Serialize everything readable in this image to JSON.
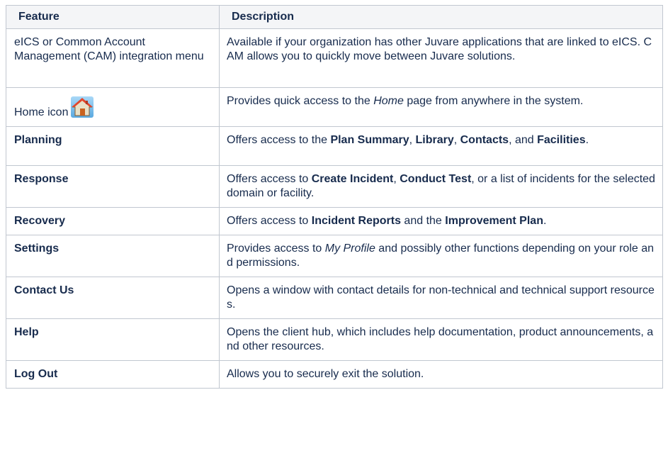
{
  "table": {
    "headers": [
      "Feature",
      "Description"
    ],
    "rows": [
      {
        "feature": "eICS or Common Account Management (CAM) integration menu",
        "feature_bold": false,
        "description": [
          {
            "text": "Available if your organization has other Juvare applications that are linked to eICS. CAM allows you to quickly move between Juvare solutions."
          }
        ]
      },
      {
        "feature": "Home icon",
        "feature_bold": false,
        "icon": "home-icon",
        "description": [
          {
            "text": "Provides quick access to the "
          },
          {
            "text": "Home",
            "style": "italic"
          },
          {
            "text": " page from anywhere in the system."
          }
        ]
      },
      {
        "feature": "Planning",
        "feature_bold": true,
        "description": [
          {
            "text": "Offers access to the "
          },
          {
            "text": "Plan Summary",
            "style": "bold"
          },
          {
            "text": ", "
          },
          {
            "text": "Library",
            "style": "bold"
          },
          {
            "text": ", "
          },
          {
            "text": "Contacts",
            "style": "bold"
          },
          {
            "text": ", and "
          },
          {
            "text": "Facilities",
            "style": "bold"
          },
          {
            "text": "."
          }
        ]
      },
      {
        "feature": "Response",
        "feature_bold": true,
        "description": [
          {
            "text": "Offers access to "
          },
          {
            "text": "Create Incident",
            "style": "bold"
          },
          {
            "text": ", "
          },
          {
            "text": "Conduct Test",
            "style": "bold"
          },
          {
            "text": ", or a list of incidents for the selected domain or facility."
          }
        ]
      },
      {
        "feature": "Recovery",
        "feature_bold": true,
        "description": [
          {
            "text": "Offers access to "
          },
          {
            "text": "Incident Reports",
            "style": "bold"
          },
          {
            "text": " and the "
          },
          {
            "text": "Improvement Plan",
            "style": "bold"
          },
          {
            "text": "."
          }
        ]
      },
      {
        "feature": "Settings",
        "feature_bold": true,
        "description": [
          {
            "text": "Provides access to "
          },
          {
            "text": "My Profile",
            "style": "italic"
          },
          {
            "text": " and possibly other functions depending on your role and permissions."
          }
        ]
      },
      {
        "feature": "Contact Us",
        "feature_bold": true,
        "description": [
          {
            "text": "Opens a window with contact details for non-technical and technical support resources."
          }
        ]
      },
      {
        "feature": "Help",
        "feature_bold": true,
        "description": [
          {
            "text": "Opens the client hub, which includes help documentation, product announcements, and other resources."
          }
        ]
      },
      {
        "feature": "Log Out",
        "feature_bold": true,
        "description": [
          {
            "text": "Allows you to securely exit the solution."
          }
        ]
      }
    ]
  },
  "colors": {
    "header_bg": "#f4f5f7",
    "border": "#c1c7d0",
    "text": "#172b4d"
  }
}
